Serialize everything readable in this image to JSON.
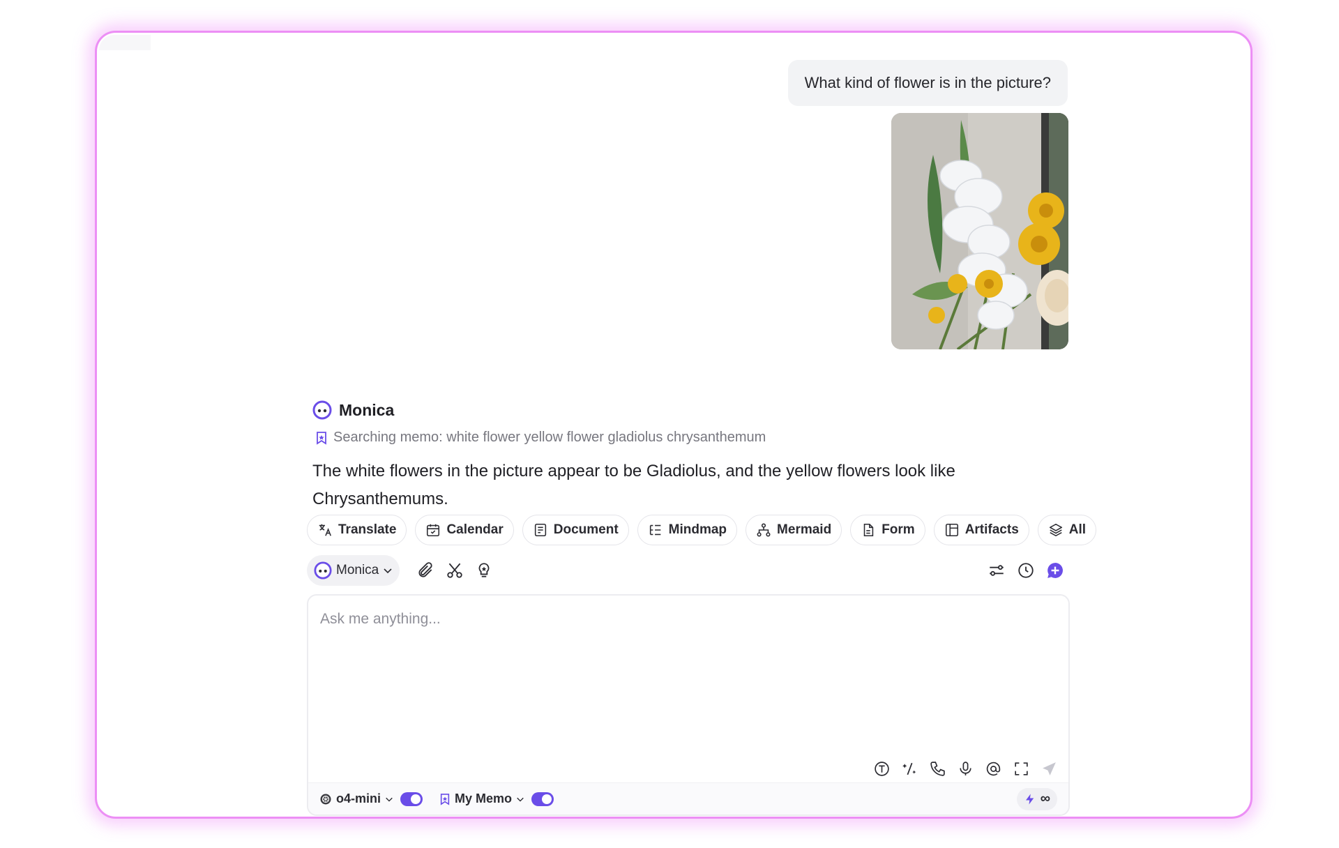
{
  "user_message": {
    "text": "What kind of flower is in the picture?",
    "attachment_icon": "flower-photo"
  },
  "assistant": {
    "name": "Monica",
    "avatar_icon": "monica-avatar-icon",
    "memo_status": "Searching memo: white flower yellow flower gladiolus chrysanthemum",
    "answer": "The white flowers in the picture appear to be Gladiolus, and the yellow flowers look like Chrysanthemums."
  },
  "tools": [
    {
      "label": "Translate",
      "icon": "translate-icon"
    },
    {
      "label": "Calendar",
      "icon": "calendar-icon"
    },
    {
      "label": "Document",
      "icon": "document-icon"
    },
    {
      "label": "Mindmap",
      "icon": "mindmap-icon"
    },
    {
      "label": "Mermaid",
      "icon": "mermaid-icon"
    },
    {
      "label": "Form",
      "icon": "form-icon"
    },
    {
      "label": "Artifacts",
      "icon": "artifacts-icon"
    },
    {
      "label": "All",
      "icon": "layers-icon"
    }
  ],
  "toolbar": {
    "bot_label": "Monica"
  },
  "input": {
    "placeholder": "Ask me anything..."
  },
  "footer": {
    "model_label": "o4-mini",
    "model_toggle_on": true,
    "memo_label": "My Memo",
    "memo_toggle_on": true,
    "credits": "∞"
  },
  "colors": {
    "accent": "#6a4de8",
    "window_border": "#ec8ff5"
  }
}
